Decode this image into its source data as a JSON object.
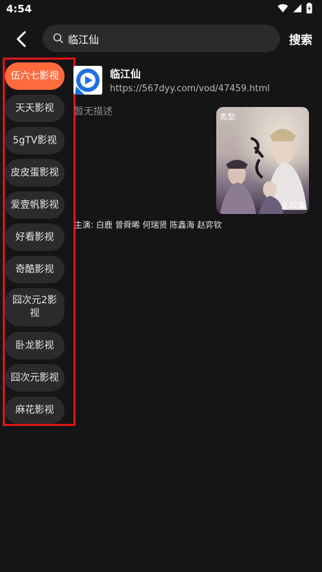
{
  "status": {
    "time": "4:54"
  },
  "search": {
    "query": "临江仙",
    "button_label": "搜索"
  },
  "sources": [
    {
      "label": "伍六七影视",
      "active": true
    },
    {
      "label": "天天影视",
      "active": false
    },
    {
      "label": "5gTV影视",
      "active": false
    },
    {
      "label": "皮皮蛋影视",
      "active": false
    },
    {
      "label": "爱壹帆影视",
      "active": false
    },
    {
      "label": "好看影视",
      "active": false
    },
    {
      "label": "奇酷影视",
      "active": false
    },
    {
      "label": "囧次元2影视",
      "active": false
    },
    {
      "label": "卧龙影视",
      "active": false
    },
    {
      "label": "囧次元影视",
      "active": false
    },
    {
      "label": "麻花影视",
      "active": false
    }
  ],
  "result": {
    "title": "临江仙",
    "url": "https://567dyy.com/vod/47459.html",
    "description": "暂无描述",
    "poster_type": "类型:",
    "poster_episodes": "全32集",
    "cast": "主演: 白鹿 曾舜晞 何瑞贤 陈鑫海 赵弈钦"
  },
  "colors": {
    "accent": "#ff6b3d",
    "outline": "#e0141a",
    "background": "#151516"
  }
}
